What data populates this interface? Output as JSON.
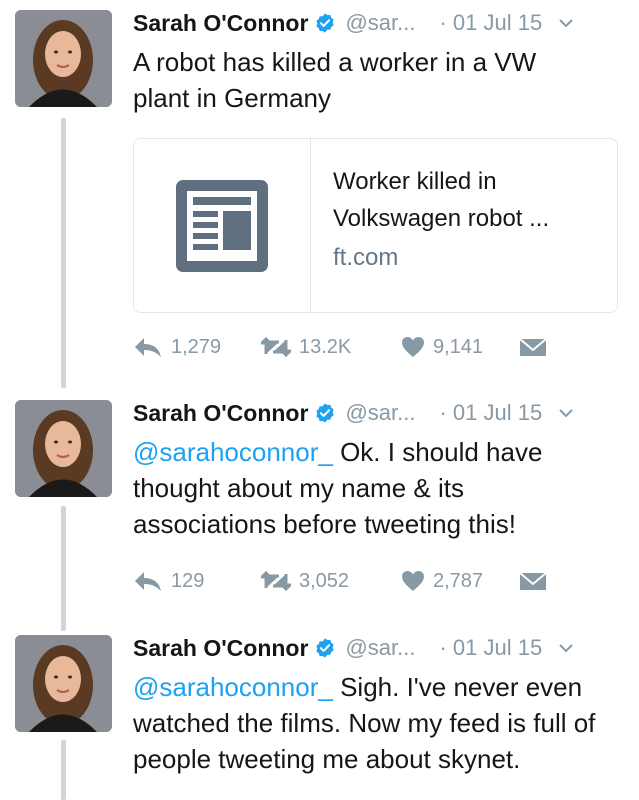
{
  "tweets": [
    {
      "name": "Sarah O'Connor",
      "handle": "@sar...",
      "date": "· 01 Jul 15",
      "text": "A robot has killed a worker in a VW plant in Germany",
      "card": {
        "title": "Worker killed in Volkswagen robot ...",
        "domain": "ft.com"
      },
      "replies": "1,279",
      "retweets": "13.2K",
      "likes": "9,141"
    },
    {
      "name": "Sarah O'Connor",
      "handle": "@sar...",
      "date": "· 01 Jul 15",
      "mention": "@sarahoconnor_",
      "text": " Ok. I should have thought about my name & its associations before tweeting this!",
      "replies": "129",
      "retweets": "3,052",
      "likes": "2,787"
    },
    {
      "name": "Sarah O'Connor",
      "handle": "@sar...",
      "date": "· 01 Jul 15",
      "mention": "@sarahoconnor_",
      "text": " Sigh. I've never even watched the films. Now my feed is full of people tweeting me about skynet."
    }
  ],
  "colors": {
    "accent": "#1da1f2",
    "secondary": "#8899a6",
    "thread": "#ccd6dd"
  },
  "icons": [
    "verified-badge-icon",
    "chevron-down-icon",
    "reply-icon",
    "retweet-icon",
    "heart-icon",
    "message-icon",
    "article-icon"
  ]
}
